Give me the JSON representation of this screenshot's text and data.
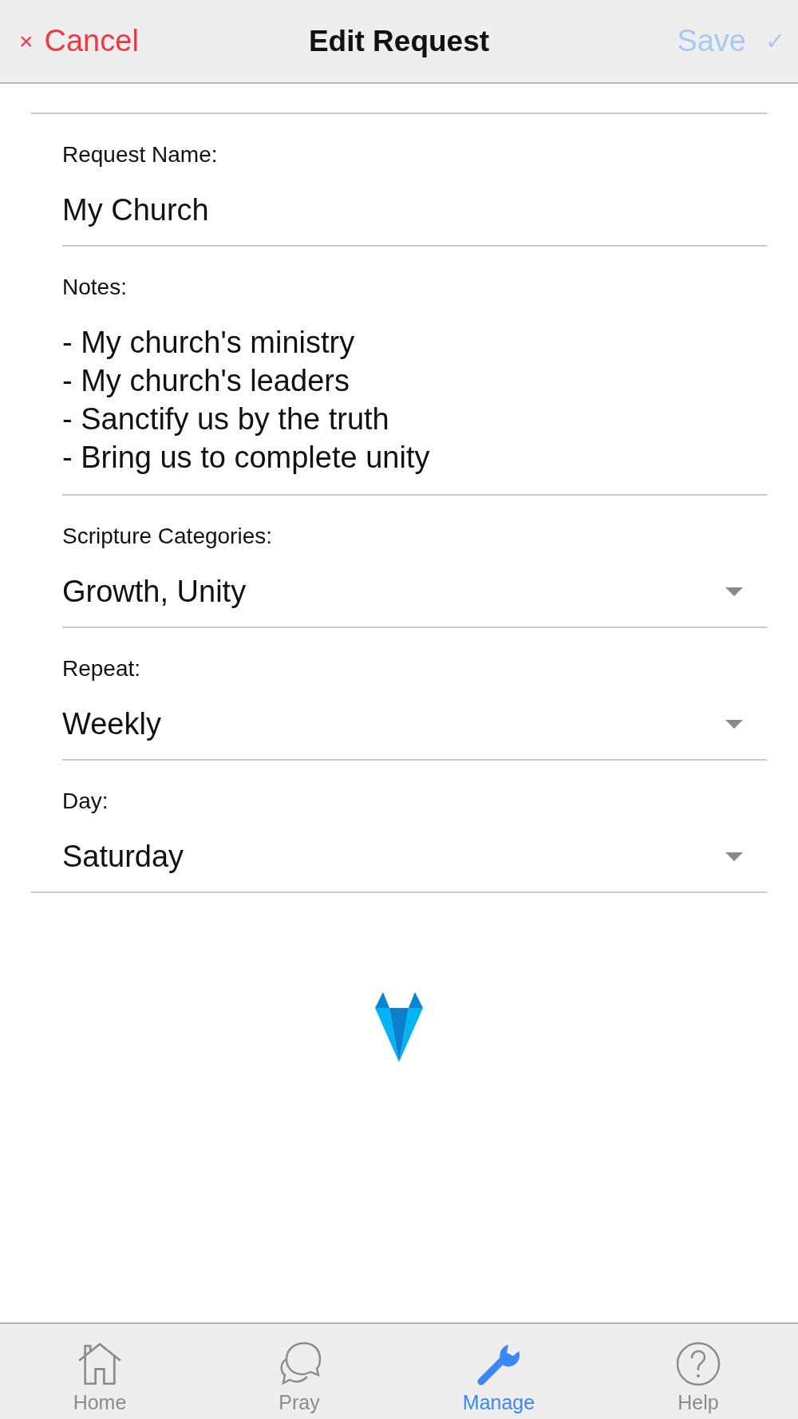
{
  "header": {
    "cancel": {
      "icon": "×",
      "label": "Cancel"
    },
    "title": "Edit Request",
    "save": {
      "label": "Save",
      "icon": "✓",
      "disabled": true
    }
  },
  "fields": [
    {
      "kind": "text",
      "label": "Request Name:",
      "value": "My Church"
    },
    {
      "kind": "multiline",
      "label": "Notes:",
      "value": "- My church's ministry\n- My church's leaders\n- Sanctify us by the truth\n- Bring us to complete unity"
    },
    {
      "kind": "select",
      "label": "Scripture Categories:",
      "value": "Growth, Unity"
    },
    {
      "kind": "select",
      "label": "Repeat:",
      "value": "Weekly"
    },
    {
      "kind": "select",
      "label": "Day:",
      "value": "Saturday"
    }
  ],
  "tabs": [
    {
      "label": "Home",
      "kind": "home",
      "selected": false
    },
    {
      "label": "Pray",
      "kind": "pray",
      "selected": false
    },
    {
      "label": "Manage",
      "kind": "manage",
      "selected": true
    },
    {
      "label": "Help",
      "kind": "help",
      "selected": false
    }
  ]
}
